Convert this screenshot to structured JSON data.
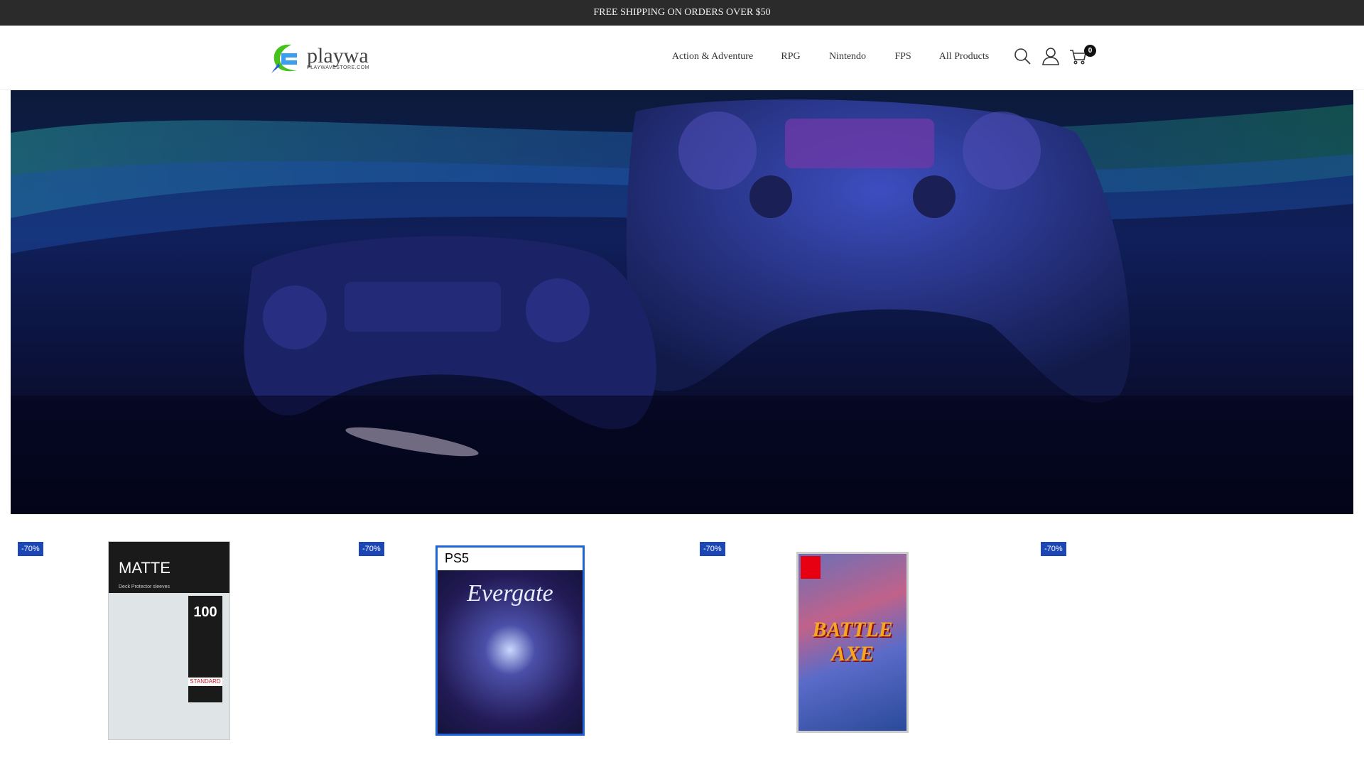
{
  "announcement": "FREE SHIPPING ON ORDERS OVER $50",
  "logo": {
    "name": "playwa",
    "tagline": "PLAYWAVESTORE.COM"
  },
  "nav": [
    "Action & Adventure",
    "RPG",
    "Nintendo",
    "FPS",
    "All Products"
  ],
  "cart_count": "0",
  "colors": {
    "topbar": "#2b2b2b",
    "badge": "#1d46b5"
  },
  "products": [
    {
      "discount": "-70%",
      "image": "Pro Matte deck protector sleeves",
      "img_text": [
        "MATTE",
        "Deck Protector sleeves",
        "100",
        "STANDARD"
      ]
    },
    {
      "discount": "-70%",
      "image": "Evergate PS5",
      "img_text": [
        "PS5",
        "Evergate"
      ]
    },
    {
      "discount": "-70%",
      "image": "BattleAxe Nintendo Switch",
      "img_text": [
        "BATTLE AXE"
      ]
    },
    {
      "discount": "-70%",
      "image": ""
    }
  ]
}
